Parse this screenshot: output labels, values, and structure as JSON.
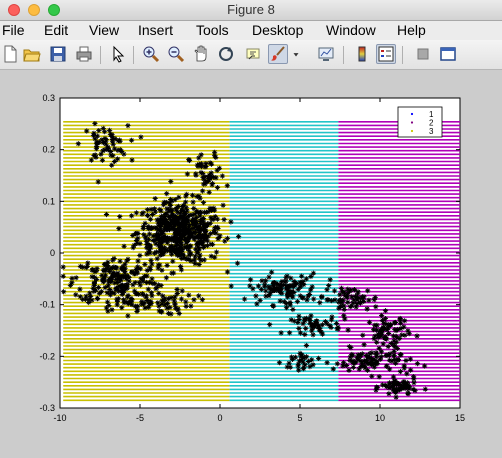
{
  "window": {
    "title": "Figure 8"
  },
  "menu": [
    "File",
    "Edit",
    "View",
    "Insert",
    "Tools",
    "Desktop",
    "Window",
    "Help"
  ],
  "toolbar": [
    "new-icon",
    "open-icon",
    "save-icon",
    "print-icon",
    "pointer-icon",
    "zoom-in-icon",
    "zoom-out-icon",
    "pan-icon",
    "rotate-icon",
    "data-cursor-icon",
    "brush-icon",
    "brush-dropdown-icon",
    "link-icon",
    "colorbar-icon",
    "legend-icon",
    "hide-tools-icon",
    "show-tools-icon"
  ],
  "chart_data": {
    "type": "scatter",
    "xlim": [
      -10,
      15
    ],
    "ylim": [
      -0.3,
      0.3
    ],
    "xticks": [
      "-10",
      "-5",
      "0",
      "5",
      "10",
      "15"
    ],
    "yticks": [
      "0.3",
      "0.2",
      "0.1",
      "0",
      "-0.1",
      "-0.2",
      "-0.3"
    ],
    "legend_position": "top-right",
    "legend": [
      {
        "label": "1",
        "color": "#0000ff"
      },
      {
        "label": "2",
        "color": "#800080"
      },
      {
        "label": "3",
        "color": "#c8c800"
      }
    ],
    "regions": [
      {
        "x_from": -9.8,
        "x_to": 0.6,
        "y_from": -0.285,
        "y_to": 0.26,
        "color": "#c8c000"
      },
      {
        "x_from": 0.6,
        "x_to": 7.4,
        "y_from": -0.285,
        "y_to": 0.26,
        "color": "#22c4c8"
      },
      {
        "x_from": 7.4,
        "x_to": 15,
        "y_from": -0.285,
        "y_to": 0.26,
        "color": "#b000b8"
      }
    ],
    "region_line_spacing": 0.007,
    "marker_color": "#000000",
    "clusters": [
      {
        "x": -2.5,
        "y": 0.04,
        "sx": 2.4,
        "sy": 0.05,
        "n": 520
      },
      {
        "x": -7.2,
        "y": 0.21,
        "sx": 1.3,
        "sy": 0.03,
        "n": 60
      },
      {
        "x": -6.5,
        "y": -0.05,
        "sx": 2.4,
        "sy": 0.035,
        "n": 170
      },
      {
        "x": -5.0,
        "y": -0.095,
        "sx": 3.0,
        "sy": 0.02,
        "n": 90
      },
      {
        "x": -0.8,
        "y": 0.15,
        "sx": 1.0,
        "sy": 0.035,
        "n": 50
      },
      {
        "x": 4.0,
        "y": -0.07,
        "sx": 2.0,
        "sy": 0.025,
        "n": 110
      },
      {
        "x": 8.2,
        "y": -0.09,
        "sx": 1.6,
        "sy": 0.02,
        "n": 60
      },
      {
        "x": 6.0,
        "y": -0.14,
        "sx": 1.4,
        "sy": 0.014,
        "n": 50
      },
      {
        "x": 10.5,
        "y": -0.155,
        "sx": 1.2,
        "sy": 0.03,
        "n": 70
      },
      {
        "x": 9.5,
        "y": -0.21,
        "sx": 2.2,
        "sy": 0.02,
        "n": 90
      },
      {
        "x": 11.2,
        "y": -0.26,
        "sx": 1.0,
        "sy": 0.015,
        "n": 60
      },
      {
        "x": 5.2,
        "y": -0.21,
        "sx": 1.2,
        "sy": 0.02,
        "n": 30
      }
    ]
  }
}
